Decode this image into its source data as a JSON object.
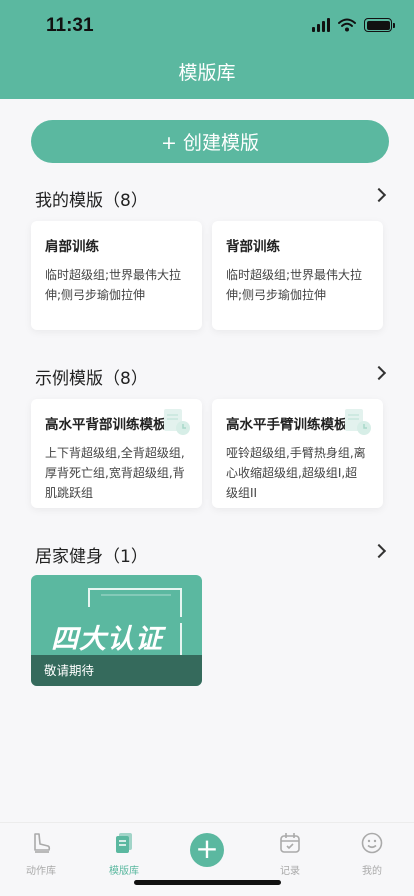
{
  "status_bar": {
    "time": "11:31"
  },
  "header": {
    "title": "模版库"
  },
  "create_button": {
    "label": "+ 创建模版"
  },
  "my_templates": {
    "title": "我的模版（8）",
    "cards": [
      {
        "title": "肩部训练",
        "desc": "临时超级组;世界最伟大拉伸;侧弓步瑜伽拉伸"
      },
      {
        "title": "背部训练",
        "desc": "临时超级组;世界最伟大拉伸;侧弓步瑜伽拉伸"
      }
    ]
  },
  "example_templates": {
    "title": "示例模版（8）",
    "cards": [
      {
        "title": "高水平背部训练模板",
        "desc": "上下背超级组,全背超级组,厚背死亡组,宽背超级组,背肌跳跃组"
      },
      {
        "title": "高水平手臂训练模板",
        "desc": "哑铃超级组,手臂热身组,离心收缩超级组,超级组I,超级组II"
      }
    ]
  },
  "home_fitness": {
    "title": "居家健身（1）",
    "card": {
      "art_text": "四大认证",
      "label": "敬请期待"
    }
  },
  "tabbar": {
    "items": [
      {
        "label": "动作库",
        "icon": "shoe-icon"
      },
      {
        "label": "模版库",
        "icon": "book-icon"
      },
      {
        "label": "记录",
        "icon": "calendar-icon"
      },
      {
        "label": "我的",
        "icon": "smile-icon"
      }
    ]
  },
  "colors": {
    "accent": "#5bb8a0",
    "inactive": "#aaaaaa"
  }
}
